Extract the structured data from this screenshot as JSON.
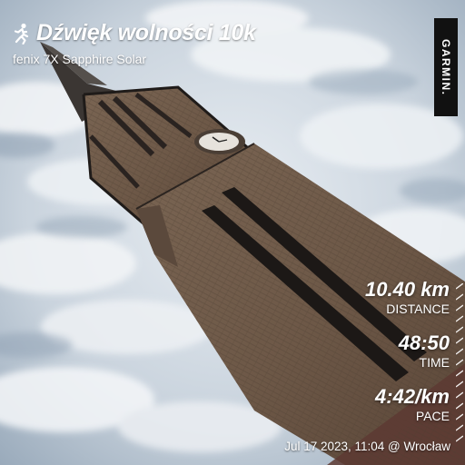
{
  "activity": {
    "title": "Dźwięk wolności 10k",
    "device": "fenix 7X Sapphire Solar",
    "icon": "running-person-icon"
  },
  "brand": {
    "name": "GARMIN."
  },
  "stats": [
    {
      "value": "10.40 km",
      "label": "DISTANCE"
    },
    {
      "value": "48:50",
      "label": "TIME"
    },
    {
      "value": "4:42/km",
      "label": "PACE"
    }
  ],
  "footer": {
    "date_location": "Jul 17 2023, 11:04 @ Wrocław"
  },
  "colors": {
    "text": "#ffffff",
    "brand_bg": "#111111",
    "sky": "#b9c6d4",
    "brick": "#6e5a49"
  }
}
